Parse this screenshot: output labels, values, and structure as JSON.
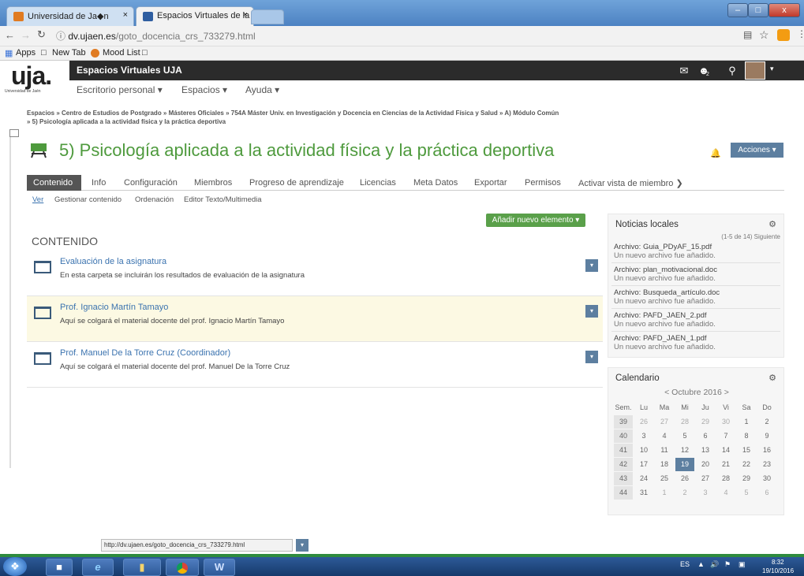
{
  "browser": {
    "tabs": [
      {
        "label": "Universidad de Ja◆n"
      },
      {
        "label": "Espacios Virtuales de la U"
      }
    ],
    "close_glyph": "×",
    "url_prefix": "dv.ujaen.es",
    "url_path": "/goto_docencia_crs_733279.html",
    "bookmarks": [
      "Apps",
      "New Tab",
      "Mood List"
    ],
    "window_buttons": [
      "–",
      "□",
      "x"
    ]
  },
  "site": {
    "logo": "uja.",
    "logo_sub": "Universidad de Jaén",
    "name": "Espacios Virtuales UJA",
    "menu": [
      "Escritorio personal ▾",
      "Espacios ▾",
      "Ayuda ▾"
    ],
    "badge_count": "2"
  },
  "breadcrumb": {
    "line1": "Espacios » Centro de Estudios de Postgrado » Másteres Oficiales » 754A Máster Univ. en Investigación y Docencia en Ciencias de la Actividad Física y Salud » A) Módulo Común",
    "line2": "» 5) Psicología aplicada a la actividad física y la práctica deportiva"
  },
  "page": {
    "title": "5) Psicología aplicada a la actividad física y la práctica deportiva",
    "actions_label": "Acciones ▾",
    "tabs": [
      "Contenido",
      "Info",
      "Configuración",
      "Miembros",
      "Progreso de aprendizaje",
      "Licencias",
      "Meta Datos",
      "Exportar",
      "Permisos",
      "Activar vista de miembro ❯"
    ],
    "subtabs": [
      "Ver",
      "Gestionar contenido",
      "Ordenación",
      "Editor Texto/Multimedia"
    ],
    "add_button": "Añadir nuevo elemento ▾",
    "content_heading": "CONTENIDO",
    "items": [
      {
        "title": "Evaluación de la asignatura",
        "desc": "En esta carpeta se incluirán los resultados de evaluación de la asignatura"
      },
      {
        "title": "Prof. Ignacio Martín Tamayo",
        "desc": "Aquí se colgará el material docente del prof. Ignacio Martín Tamayo"
      },
      {
        "title": "Prof. Manuel De la Torre Cruz (Coordinador)",
        "desc": "Aquí se colgará el material docente del prof. Manuel De la Torre Cruz"
      }
    ],
    "item_button_glyph": "▾"
  },
  "news": {
    "title": "Noticias locales",
    "pager": "(1-5 de 14) Siguiente",
    "items": [
      {
        "file": "Archivo: Guia_PDyAF_15.pdf",
        "desc": "Un nuevo archivo fue añadido."
      },
      {
        "file": "Archivo: plan_motivacional.doc",
        "desc": "Un nuevo archivo fue añadido."
      },
      {
        "file": "Archivo: Busqueda_artículo.doc",
        "desc": "Un nuevo archivo fue añadido."
      },
      {
        "file": "Archivo: PAFD_JAEN_2.pdf",
        "desc": "Un nuevo archivo fue añadido."
      },
      {
        "file": "Archivo: PAFD_JAEN_1.pdf",
        "desc": "Un nuevo archivo fue añadido."
      }
    ]
  },
  "calendar": {
    "title": "Calendario",
    "month": "< Octubre 2016 >",
    "headers": [
      "Sem.",
      "Lu",
      "Ma",
      "Mi",
      "Ju",
      "Vi",
      "Sa",
      "Do"
    ],
    "weeks": [
      [
        "39",
        "26",
        "27",
        "28",
        "29",
        "30",
        "1",
        "2"
      ],
      [
        "40",
        "3",
        "4",
        "5",
        "6",
        "7",
        "8",
        "9"
      ],
      [
        "41",
        "10",
        "11",
        "12",
        "13",
        "14",
        "15",
        "16"
      ],
      [
        "42",
        "17",
        "18",
        "19",
        "20",
        "21",
        "22",
        "23"
      ],
      [
        "43",
        "24",
        "25",
        "26",
        "27",
        "28",
        "29",
        "30"
      ],
      [
        "44",
        "31",
        "1",
        "2",
        "3",
        "4",
        "5",
        "6"
      ]
    ],
    "today": "19"
  },
  "status_url": "http://dv.ujaen.es/goto_docencia_crs_733279.html",
  "taskbar": {
    "lang": "ES",
    "time": "8:32",
    "date": "19/10/2016",
    "apps": [
      "explorer-icon",
      "ie-icon",
      "folder-icon",
      "chrome-icon",
      "word-icon"
    ]
  }
}
